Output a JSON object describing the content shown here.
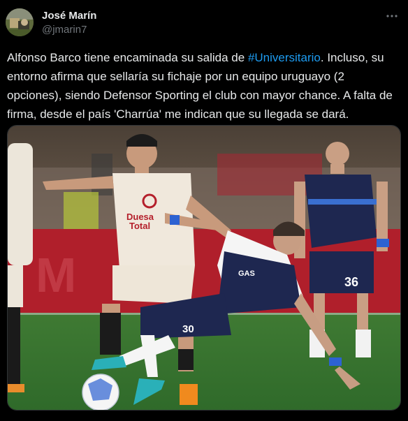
{
  "author": {
    "display_name": "José Marín",
    "handle": "@jmarin7"
  },
  "tweet": {
    "text_before": "Alfonso Barco tiene encaminada su salida de ",
    "hashtag": "#Universitario",
    "text_after": ". Incluso, su entorno afirma que sellaría su fichaje por un equipo uruguayo (2 opciones), siendo Defensor Sporting el club con mayor chance. A falta de firma, desde el país 'Charrúa' me indican que su llegada se dará."
  },
  "photo": {
    "description_icon": "photo-football-match",
    "shirt_number_left": "30",
    "shirt_number_right": "36"
  },
  "colors": {
    "background": "#000000",
    "text": "#e7e9ea",
    "muted": "#71767b",
    "link": "#1d9bf0"
  }
}
